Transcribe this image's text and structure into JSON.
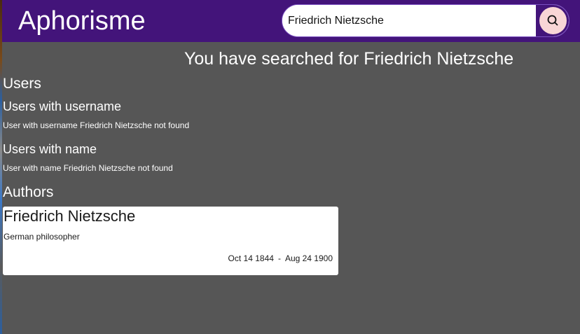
{
  "header": {
    "brand": "Aphorisme",
    "search": {
      "value": "Friedrich Nietzsche",
      "icon": "search-icon"
    }
  },
  "main": {
    "heading": "You have searched for Friedrich Nietzsche",
    "users": {
      "title": "Users",
      "by_username": {
        "title": "Users with username",
        "message": "User with username Friedrich Nietzsche not found"
      },
      "by_name": {
        "title": "Users with name",
        "message": "User with name Friedrich Nietzsche not found"
      }
    },
    "authors": {
      "title": "Authors",
      "items": [
        {
          "name": "Friedrich Nietzsche",
          "description": "German philosopher",
          "born": "Oct 14 1844",
          "separator": "-",
          "died": "Aug 24 1900"
        }
      ]
    }
  },
  "colors": {
    "header_bg": "#43147a",
    "page_bg": "#565656",
    "search_button_circle": "#f9d6d6",
    "card_bg": "#ffffff"
  }
}
